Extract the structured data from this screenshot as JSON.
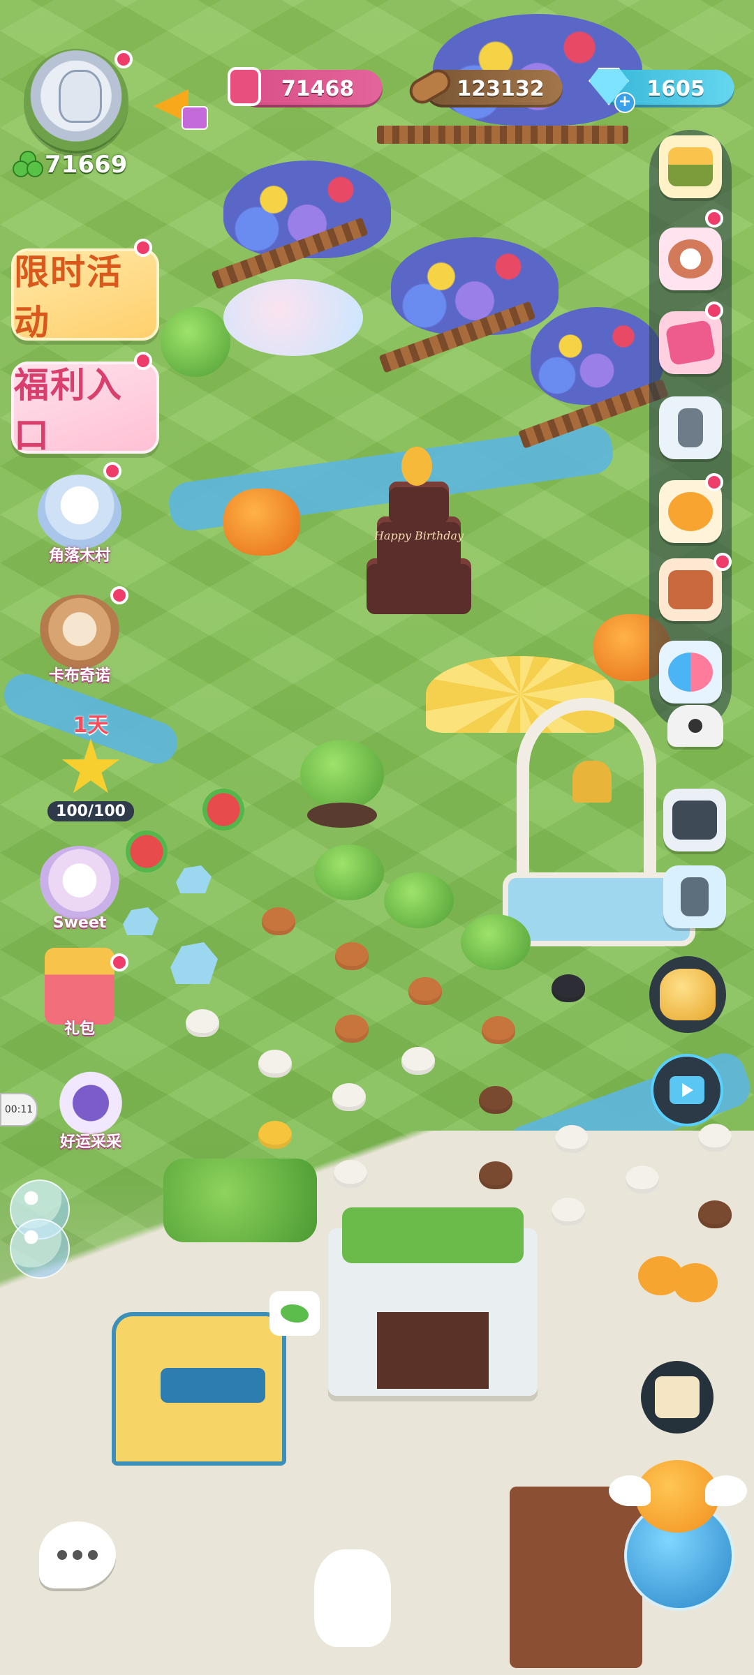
{
  "hud": {
    "hearts": {
      "icon": "heart-jar-icon",
      "value": "71468"
    },
    "wood": {
      "icon": "wood-log-icon",
      "value": "123132"
    },
    "gems": {
      "icon": "gem-icon",
      "value": "1605",
      "add_icon": "plus-icon"
    }
  },
  "player": {
    "avatar_icon": "player-avatar",
    "clover_icon": "clover-icon",
    "clover_count": "71669"
  },
  "left_menu": {
    "limited_event": "限时活动",
    "welfare": "福利入口",
    "village": "角落木村",
    "kabu": "卡布奇诺",
    "star_days": "1天",
    "star_progress": "100/100",
    "sweet": "Sweet",
    "gift": "礼包",
    "lucky_pick": "好运采采",
    "timer": "00:11"
  },
  "right_menu": [
    {
      "icon": "shop-stall-icon"
    },
    {
      "icon": "animal-friends-icon"
    },
    {
      "icon": "cards-icon"
    },
    {
      "icon": "phone-icon"
    },
    {
      "icon": "chick-chat-icon"
    },
    {
      "icon": "book-icon"
    },
    {
      "icon": "qa-icon"
    },
    {
      "icon": "panda-icon"
    },
    {
      "icon": "camera-icon"
    },
    {
      "icon": "mobile-icon"
    },
    {
      "icon": "golden-statue-icon"
    },
    {
      "icon": "tv-ad-icon"
    },
    {
      "icon": "chicks-icon"
    },
    {
      "icon": "task-scroll-icon"
    },
    {
      "icon": "flying-chick-globe-icon"
    }
  ],
  "cake_text": "Happy Birthday",
  "chat_icon": "chat-bubble-icon",
  "colors": {
    "grass": "#7bbd4f",
    "river": "#5fb6d8",
    "accent_pink": "#ef3d6b",
    "limited_text": "#d9591d",
    "welfare_text": "#d83f6c"
  }
}
